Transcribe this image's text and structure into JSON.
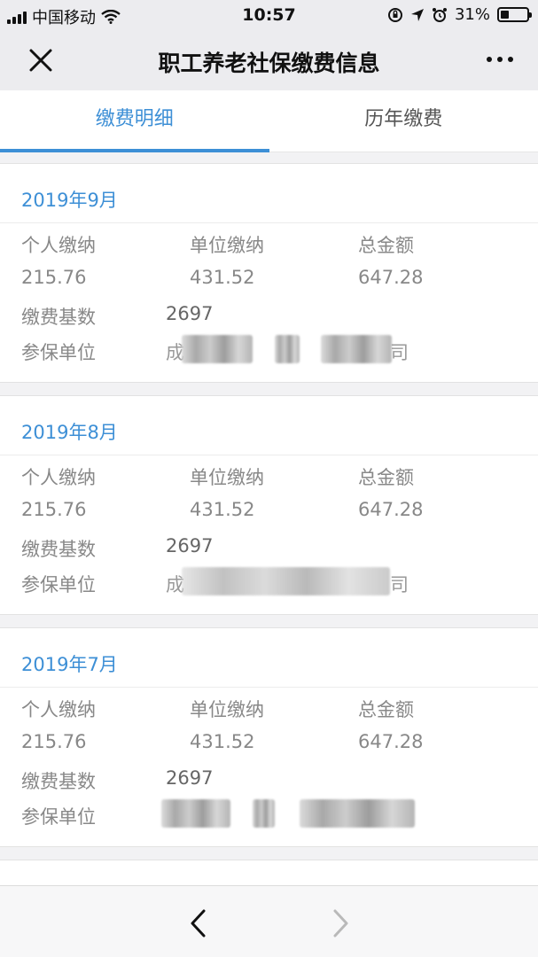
{
  "status_bar": {
    "carrier": "中国移动",
    "time": "10:57",
    "battery": "31%",
    "battery_level": 0.31
  },
  "nav": {
    "title": "职工养老社保缴费信息",
    "icons": [
      "close-icon",
      "more-icon"
    ]
  },
  "tabs": [
    {
      "label": "缴费明细",
      "active": true
    },
    {
      "label": "历年缴费",
      "active": false
    }
  ],
  "labels": {
    "personal": "个人缴纳",
    "employer": "单位缴纳",
    "total": "总金额",
    "base": "缴费基数",
    "unit": "参保单位"
  },
  "records": [
    {
      "month": "2019年9月",
      "personal": "215.76",
      "employer": "431.52",
      "total": "647.28",
      "base": "2697"
    },
    {
      "month": "2019年8月",
      "personal": "215.76",
      "employer": "431.52",
      "total": "647.28",
      "base": "2697"
    },
    {
      "month": "2019年7月",
      "personal": "215.76",
      "employer": "431.52",
      "total": "647.28",
      "base": "2697"
    }
  ],
  "unit_fragments": [
    "成",
    "司",
    "成",
    "司"
  ],
  "bottom_nav": {
    "icons": [
      "back-arrow-icon",
      "forward-arrow-icon"
    ]
  }
}
